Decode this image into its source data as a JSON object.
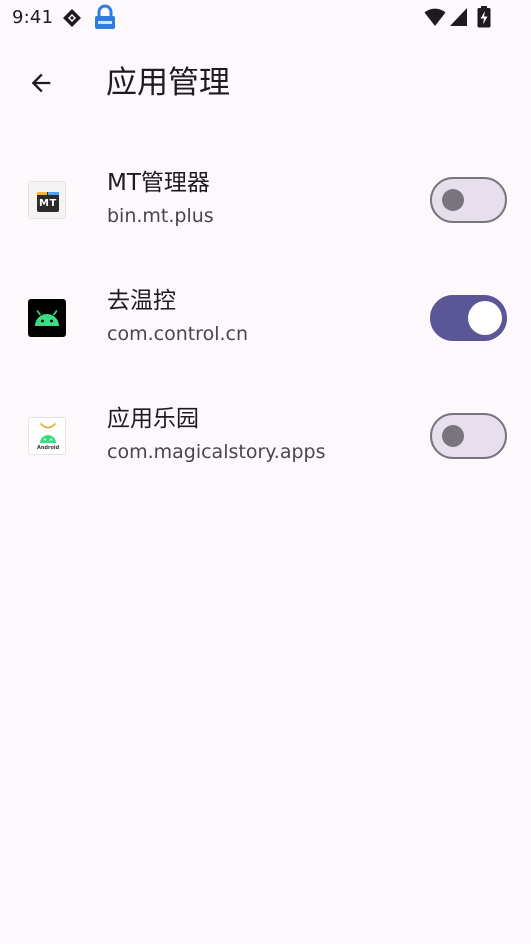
{
  "status_bar": {
    "time": "9:41",
    "icons_left": [
      "diamond-signal-icon",
      "vpn-lock-icon"
    ],
    "icons_right": [
      "wifi-icon",
      "cell-signal-icon",
      "battery-charging-icon"
    ]
  },
  "app_bar": {
    "back_icon": "arrow-back-icon",
    "title": "应用管理"
  },
  "apps": [
    {
      "name": "MT管理器",
      "package": "bin.mt.plus",
      "icon": "mt-manager-icon",
      "icon_text": "MT",
      "enabled": false
    },
    {
      "name": "去温控",
      "package": "com.control.cn",
      "icon": "android-robot-icon",
      "enabled": true
    },
    {
      "name": "应用乐园",
      "package": "com.magicalstory.apps",
      "icon": "app-paradise-icon",
      "icon_text": "Android",
      "enabled": false
    }
  ],
  "colors": {
    "background": "#fcf8fc",
    "toggle_on": "#5b5696",
    "toggle_off_track": "#e7e0ec",
    "toggle_off_outline": "#79747e",
    "android_green": "#3ddc84"
  }
}
